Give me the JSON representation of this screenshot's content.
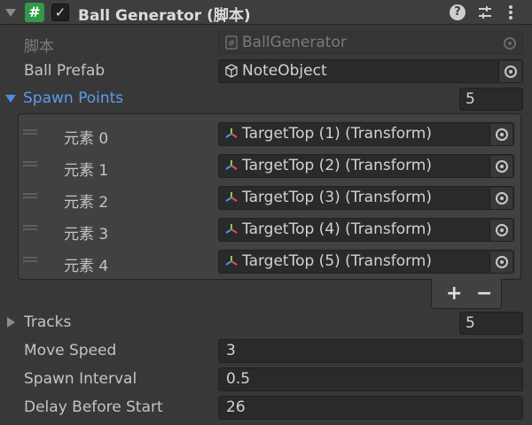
{
  "header": {
    "title": "Ball Generator   (脚本)",
    "enabled": true,
    "script_badge": "#",
    "icons": [
      "help-icon",
      "presets-icon",
      "more-icon"
    ]
  },
  "script": {
    "label": "脚本",
    "value": "BallGenerator"
  },
  "ball_prefab": {
    "label": "Ball Prefab",
    "value": "NoteObject"
  },
  "spawn_points": {
    "label": "Spawn Points",
    "count": "5",
    "expanded": true,
    "items": [
      {
        "label": "元素 0",
        "value": "TargetTop (1) (Transform)"
      },
      {
        "label": "元素 1",
        "value": "TargetTop (2) (Transform)"
      },
      {
        "label": "元素 2",
        "value": "TargetTop (3) (Transform)"
      },
      {
        "label": "元素 3",
        "value": "TargetTop (4) (Transform)"
      },
      {
        "label": "元素 4",
        "value": "TargetTop (5) (Transform)"
      }
    ],
    "add_label": "+",
    "remove_label": "−"
  },
  "tracks": {
    "label": "Tracks",
    "count": "5",
    "expanded": false
  },
  "move_speed": {
    "label": "Move Speed",
    "value": "3"
  },
  "spawn_interval": {
    "label": "Spawn Interval",
    "value": "0.5"
  },
  "delay_before_start": {
    "label": "Delay Before Start",
    "value": "26"
  }
}
